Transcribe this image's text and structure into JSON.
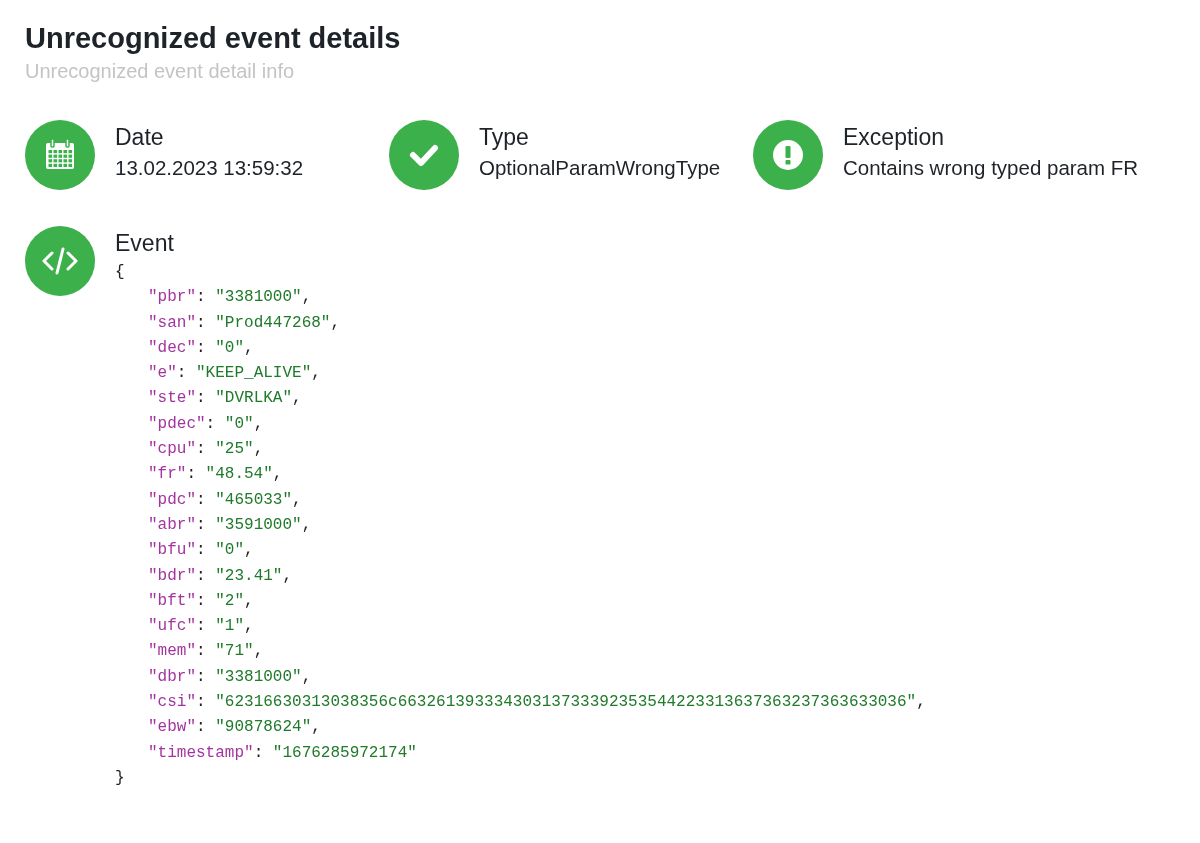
{
  "header": {
    "title": "Unrecognized event details",
    "subtitle": "Unrecognized event detail info"
  },
  "details": [
    {
      "kind": "calendar",
      "label": "Date",
      "value": "13.02.2023 13:59:32"
    },
    {
      "kind": "check",
      "label": "Type",
      "value": "OptionalParamWrongType"
    },
    {
      "kind": "exclamation",
      "label": "Exception",
      "value": "Contains wrong typed param FR"
    }
  ],
  "event": {
    "kind": "code",
    "label": "Event",
    "open": "{",
    "close": "}",
    "fields": [
      {
        "key": "\"pbr\"",
        "colon": ":",
        "value": "\"3381000\"",
        "comma": ","
      },
      {
        "key": "\"san\"",
        "colon": ":",
        "value": "\"Prod447268\"",
        "comma": ","
      },
      {
        "key": "\"dec\"",
        "colon": ":",
        "value": "\"0\"",
        "comma": ","
      },
      {
        "key": "\"e\"",
        "colon": ":",
        "value": "\"KEEP_ALIVE\"",
        "comma": ","
      },
      {
        "key": "\"ste\"",
        "colon": ":",
        "value": "\"DVRLKA\"",
        "comma": ","
      },
      {
        "key": "\"pdec\"",
        "colon": ":",
        "value": "\"0\"",
        "comma": ","
      },
      {
        "key": "\"cpu\"",
        "colon": ":",
        "value": "\"25\"",
        "comma": ","
      },
      {
        "key": "\"fr\"",
        "colon": ":",
        "value": "\"48.54\"",
        "comma": ","
      },
      {
        "key": "\"pdc\"",
        "colon": ":",
        "value": "\"465033\"",
        "comma": ","
      },
      {
        "key": "\"abr\"",
        "colon": ":",
        "value": "\"3591000\"",
        "comma": ","
      },
      {
        "key": "\"bfu\"",
        "colon": ":",
        "value": "\"0\"",
        "comma": ","
      },
      {
        "key": "\"bdr\"",
        "colon": ":",
        "value": "\"23.41\"",
        "comma": ","
      },
      {
        "key": "\"bft\"",
        "colon": ":",
        "value": "\"2\"",
        "comma": ","
      },
      {
        "key": "\"ufc\"",
        "colon": ":",
        "value": "\"1\"",
        "comma": ","
      },
      {
        "key": "\"mem\"",
        "colon": ":",
        "value": "\"71\"",
        "comma": ","
      },
      {
        "key": "\"dbr\"",
        "colon": ":",
        "value": "\"3381000\"",
        "comma": ","
      },
      {
        "key": "\"csi\"",
        "colon": ":",
        "value": "\"62316630313038356c66326139333430313733392353544223313637363237363633036\"",
        "comma": ","
      },
      {
        "key": "\"ebw\"",
        "colon": ":",
        "value": "\"90878624\"",
        "comma": ","
      },
      {
        "key": "\"timestamp\"",
        "colon": ":",
        "value": "\"1676285972174\""
      }
    ]
  }
}
